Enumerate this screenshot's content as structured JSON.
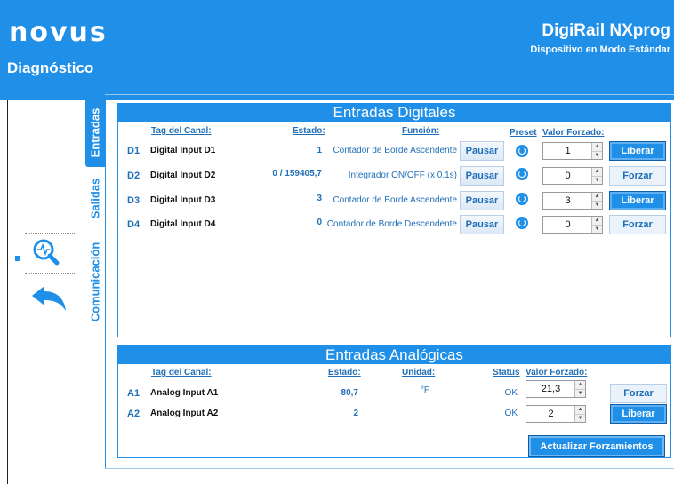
{
  "header": {
    "logo": "novus",
    "page_title": "Diagnóstico",
    "product_name": "DigiRail NXprog",
    "product_subtitle": "Dispositivo en Modo Estándar"
  },
  "tabs": [
    "Entradas",
    "Salidas",
    "Comunicación"
  ],
  "active_tab": "Entradas",
  "digital": {
    "title": "Entradas Digitales",
    "headers": {
      "tag": "Tag del Canal:",
      "state": "Estado:",
      "function": "Función:",
      "preset": "Preset",
      "forced": "Valor Forzado:"
    },
    "rows": [
      {
        "id": "D1",
        "name": "Digital Input D1",
        "state": "1",
        "function": "Contador de Borde Ascendente",
        "pause": "Pausar",
        "forced": "1",
        "action": "Liberar"
      },
      {
        "id": "D2",
        "name": "Digital Input D2",
        "state": "0 / 159405,7",
        "function": "Integrador ON/OFF (x 0.1s)",
        "pause": "Pausar",
        "forced": "0",
        "action": "Forzar"
      },
      {
        "id": "D3",
        "name": "Digital Input D3",
        "state": "3",
        "function": "Contador de Borde Ascendente",
        "pause": "Pausar",
        "forced": "3",
        "action": "Liberar"
      },
      {
        "id": "D4",
        "name": "Digital Input D4",
        "state": "0",
        "function": "Contador de Borde Descendente",
        "pause": "Pausar",
        "forced": "0",
        "action": "Forzar"
      }
    ]
  },
  "analog": {
    "title": "Entradas Analógicas",
    "headers": {
      "tag": "Tag del Canal:",
      "state": "Estado:",
      "unit": "Unidad:",
      "status": "Status",
      "forced": "Valor Forzado:"
    },
    "rows": [
      {
        "id": "A1",
        "name": "Analog Input A1",
        "state": "80,7",
        "unit": "°F",
        "status": "OK",
        "forced": "21,3",
        "action": "Forzar"
      },
      {
        "id": "A2",
        "name": "Analog Input A2",
        "state": "2",
        "unit": "",
        "status": "OK",
        "forced": "2",
        "action": "Liberar"
      }
    ]
  },
  "update_button": "Actualizar Forzamientos",
  "colors": {
    "accent": "#1f8fe8",
    "text_blue": "#1f6fb8"
  }
}
